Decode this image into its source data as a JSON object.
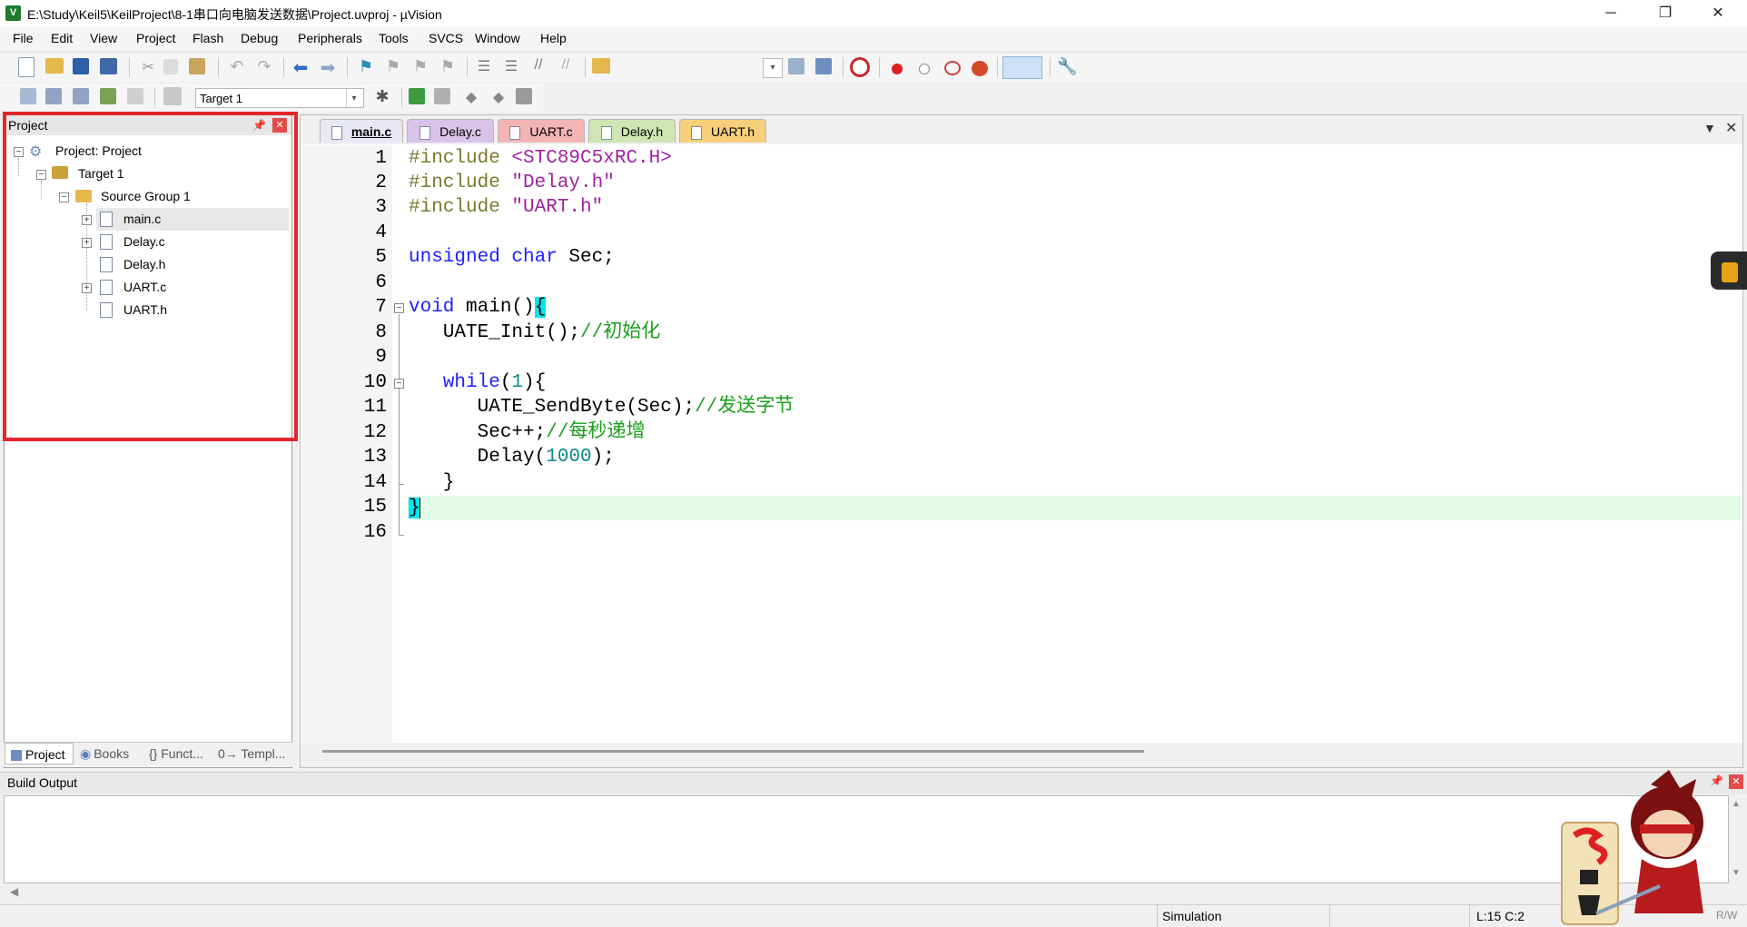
{
  "window": {
    "title": "E:\\Study\\Keil5\\KeilProject\\8-1串口向电脑发送数据\\Project.uvproj - µVision",
    "app_icon_text": "V",
    "controls": {
      "minimize": "─",
      "restore": "❐",
      "close": "✕"
    }
  },
  "menu": [
    "File",
    "Edit",
    "View",
    "Project",
    "Flash",
    "Debug",
    "Peripherals",
    "Tools",
    "SVCS",
    "Window",
    "Help"
  ],
  "toolbar": {
    "target_select": "Target 1",
    "icons_row1": [
      "new-file-icon",
      "open-icon",
      "save-icon",
      "save-all-icon",
      "cut-icon",
      "copy-icon",
      "paste-icon",
      "undo-icon",
      "redo-icon",
      "nav-back-icon",
      "nav-forward-icon",
      "bookmark-icon",
      "bookmark-prev-icon",
      "bookmark-next-icon",
      "bookmark-clear-icon",
      "indent-icon",
      "unindent-icon",
      "comment-icon",
      "uncomment-icon",
      "find-in-files-icon",
      "find-icon",
      "incremental-find-icon",
      "debug-start-icon",
      "breakpoint-insert-icon",
      "breakpoint-disable-icon",
      "breakpoint-disable-all-icon",
      "breakpoint-kill-all-icon",
      "window-layout-icon",
      "configure-icon"
    ],
    "icons_row2": [
      "translate-icon",
      "build-icon",
      "rebuild-icon",
      "batch-build-icon",
      "stop-build-icon",
      "download-icon",
      "options-target-icon",
      "manage-components-icon",
      "select-pack-icon",
      "software-packs-icon",
      "rte-icon",
      "pack-installer-icon"
    ]
  },
  "project_pane": {
    "title": "Project",
    "tree": [
      {
        "label": "Project: Project",
        "level": 0,
        "type": "project"
      },
      {
        "label": "Target 1",
        "level": 1,
        "type": "target"
      },
      {
        "label": "Source Group 1",
        "level": 2,
        "type": "folder"
      },
      {
        "label": "main.c",
        "level": 3,
        "type": "file",
        "expandable": true
      },
      {
        "label": "Delay.c",
        "level": 3,
        "type": "file",
        "expandable": true
      },
      {
        "label": "Delay.h",
        "level": 3,
        "type": "file",
        "expandable": false
      },
      {
        "label": "UART.c",
        "level": 3,
        "type": "file",
        "expandable": true
      },
      {
        "label": "UART.h",
        "level": 3,
        "type": "file",
        "expandable": false
      }
    ],
    "tabs": [
      "Project",
      "Books",
      "{} Funct...",
      "0→ Templ..."
    ]
  },
  "editor": {
    "tabs": [
      {
        "label": "main.c",
        "color": "#e8e8f4",
        "active": true
      },
      {
        "label": "Delay.c",
        "color": "#d9c3e9"
      },
      {
        "label": "UART.c",
        "color": "#f3b4b4"
      },
      {
        "label": "Delay.h",
        "color": "#cfe6b4"
      },
      {
        "label": "UART.h",
        "color": "#f7cf7a"
      }
    ],
    "line_numbers": [
      "1",
      "2",
      "3",
      "4",
      "5",
      "6",
      "7",
      "8",
      "9",
      "10",
      "11",
      "12",
      "13",
      "14",
      "15",
      "16"
    ],
    "lines": [
      {
        "pp": "#include ",
        "str": "<STC89C5xRC.H>"
      },
      {
        "pp": "#include ",
        "str": "\"Delay.h\""
      },
      {
        "pp": "#include ",
        "str": "\"UART.h\""
      },
      {},
      {
        "kw": "unsigned char",
        "rest": " Sec;"
      },
      {},
      {
        "kw": "void",
        "rest": " main()",
        "brace": "{"
      },
      {
        "indent": "   ",
        "rest": "UATE_Init();",
        "cm": "//初始化"
      },
      {},
      {
        "indent": "   ",
        "kw": "while",
        "p1": "(",
        "num": "1",
        "p2": "){"
      },
      {
        "indent": "      ",
        "rest": "UATE_SendByte(Sec);",
        "cm": "//发送字节"
      },
      {
        "indent": "      ",
        "rest": "Sec++;",
        "cm": "//每秒递增"
      },
      {
        "indent": "      ",
        "rest": "Delay(",
        "num": "1000",
        "p2": ");"
      },
      {
        "indent": "   ",
        "rest": "}"
      },
      {
        "brace": "}"
      },
      {}
    ],
    "current_line": "15"
  },
  "build_output": {
    "title": "Build Output"
  },
  "status": {
    "mode": "Simulation",
    "position": "L:15 C:2",
    "rw": "R/W"
  },
  "colors": {
    "highlight_box": "#e3262b",
    "current_line": "#e2fbe6",
    "brace_match": "#00e5ee"
  }
}
